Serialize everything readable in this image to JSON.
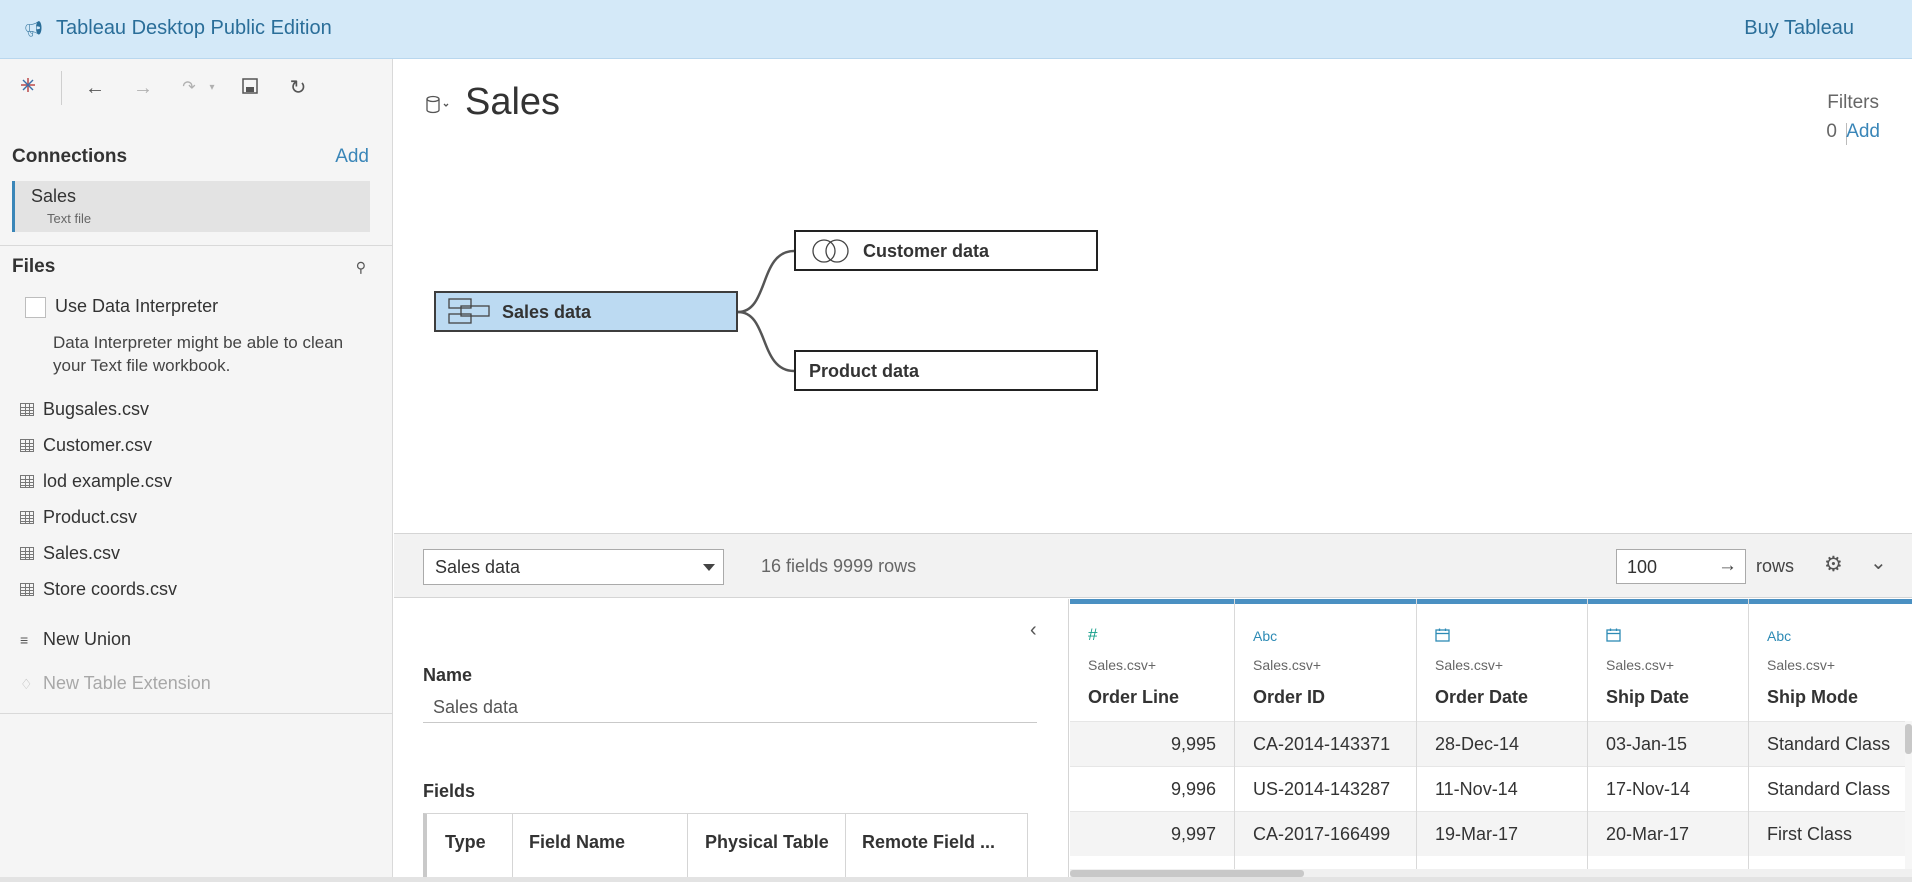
{
  "banner": {
    "title": "Tableau Desktop Public Edition",
    "buy_label": "Buy Tableau"
  },
  "toolbar": {
    "icons": [
      "tableau-logo-icon",
      "back-icon",
      "forward-icon",
      "paste-icon",
      "save-icon",
      "refresh-icon"
    ]
  },
  "connections": {
    "heading": "Connections",
    "add_label": "Add",
    "items": [
      {
        "name": "Sales",
        "type": "Text file"
      }
    ]
  },
  "files": {
    "heading": "Files",
    "interpreter_label": "Use Data Interpreter",
    "interpreter_hint": "Data Interpreter might be able to clean your Text file workbook.",
    "items": [
      "Bugsales.csv",
      "Customer.csv",
      "lod example.csv",
      "Product.csv",
      "Sales.csv",
      "Store coords.csv"
    ],
    "new_union": "New Union",
    "new_table_extension": "New Table Extension"
  },
  "canvas": {
    "title": "Sales",
    "filters_label": "Filters",
    "filters_count": "0",
    "filters_add": "Add",
    "nodes": {
      "primary": "Sales data",
      "related": [
        "Customer data",
        "Product data"
      ]
    }
  },
  "grid_bar": {
    "selected_table": "Sales data",
    "fields_summary": "16 fields 9999 rows",
    "rows_value": "100",
    "rows_label": "rows"
  },
  "metadata": {
    "name_label": "Name",
    "name_value": "Sales data",
    "fields_label": "Fields",
    "columns": [
      "Type",
      "Field Name",
      "Physical Table",
      "Remote Field ..."
    ]
  },
  "grid": {
    "columns": [
      {
        "type_icon": "#",
        "source": "Sales.csv+",
        "name": "Order Line"
      },
      {
        "type_icon": "Abc",
        "source": "Sales.csv+",
        "name": "Order ID"
      },
      {
        "type_icon": "calendar-icon",
        "source": "Sales.csv+",
        "name": "Order Date"
      },
      {
        "type_icon": "calendar-icon",
        "source": "Sales.csv+",
        "name": "Ship Date"
      },
      {
        "type_icon": "Abc",
        "source": "Sales.csv+",
        "name": "Ship Mode"
      }
    ],
    "rows": [
      [
        "9,995",
        "CA-2014-143371",
        "28-Dec-14",
        "03-Jan-15",
        "Standard Class"
      ],
      [
        "9,996",
        "US-2014-143287",
        "11-Nov-14",
        "17-Nov-14",
        "Standard Class"
      ],
      [
        "9,997",
        "CA-2017-166499",
        "19-Mar-17",
        "20-Mar-17",
        "First Class"
      ]
    ]
  },
  "colors": {
    "banner_bg": "#d4e9f8",
    "accent": "#3a86b8",
    "selected_node": "#bcdaf2"
  }
}
